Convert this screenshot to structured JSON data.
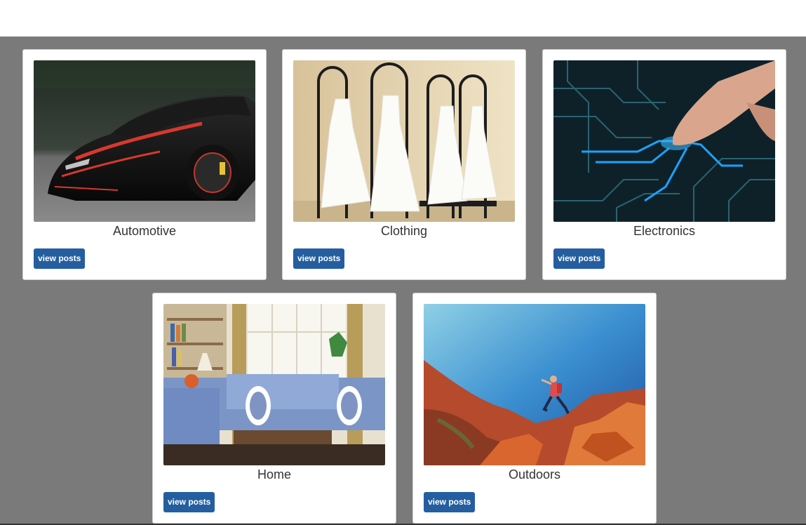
{
  "categories": [
    {
      "title": "Automotive",
      "button_label": "view posts",
      "image": "sports-car-photo"
    },
    {
      "title": "Clothing",
      "button_label": "view posts",
      "image": "wedding-dresses-photo"
    },
    {
      "title": "Electronics",
      "button_label": "view posts",
      "image": "circuit-board-photo"
    },
    {
      "title": "Home",
      "button_label": "view posts",
      "image": "living-room-photo"
    },
    {
      "title": "Outdoors",
      "button_label": "view posts",
      "image": "hiker-jumping-photo"
    }
  ],
  "colors": {
    "background": "#7a7a7a",
    "card": "#ffffff",
    "button": "#245ea0",
    "button_text": "#ffffff",
    "title_text": "#333333"
  }
}
